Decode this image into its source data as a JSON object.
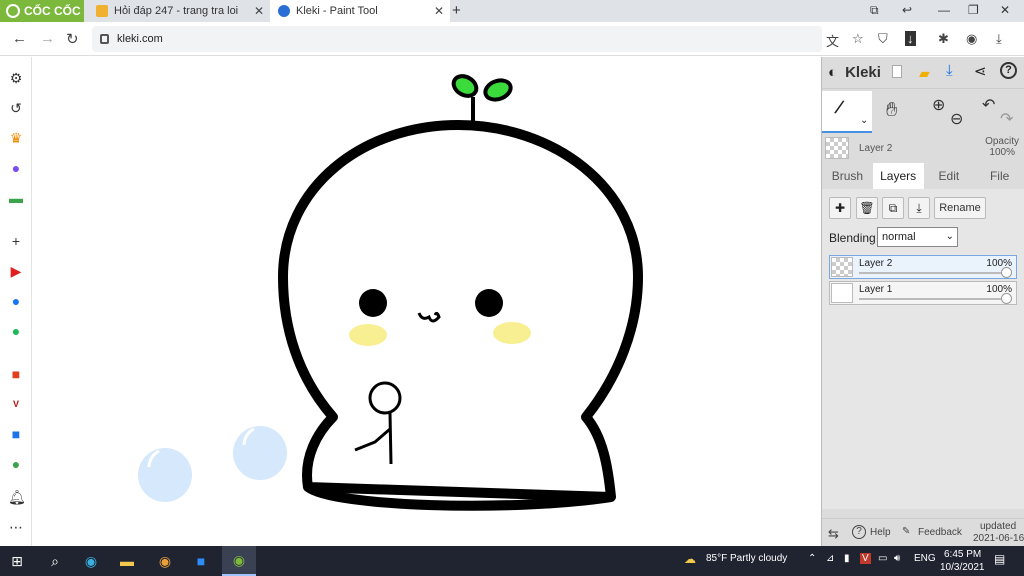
{
  "browser": {
    "brand": "CỐC CỐC",
    "tabs": [
      {
        "title": "Hỏi đáp 247 - trang tra loi",
        "active": false
      },
      {
        "title": "Kleki - Paint Tool",
        "active": true
      }
    ],
    "url": "kleki.com",
    "accent": "#7bb83c"
  },
  "kleki": {
    "title": "Kleki",
    "current_layer": {
      "name": "Layer 2",
      "opacity_label": "Opacity",
      "opacity_value": "100%"
    },
    "tabs": [
      {
        "label": "Brush",
        "active": false
      },
      {
        "label": "Layers",
        "active": true
      },
      {
        "label": "Edit",
        "active": false
      },
      {
        "label": "File",
        "active": false
      }
    ],
    "rename_label": "Rename",
    "blending_label": "Blending",
    "blending_value": "normal",
    "layers": [
      {
        "name": "Layer 2",
        "opacity": "100%",
        "selected": true
      },
      {
        "name": "Layer 1",
        "opacity": "100%",
        "selected": false
      }
    ],
    "footer": {
      "help": "Help",
      "feedback": "Feedback",
      "updated": "updated",
      "updated_date": "2021-06-16"
    }
  },
  "taskbar": {
    "weather": "85°F  Partly cloudy",
    "lang": "ENG",
    "time": "6:45 PM",
    "date": "10/3/2021"
  }
}
